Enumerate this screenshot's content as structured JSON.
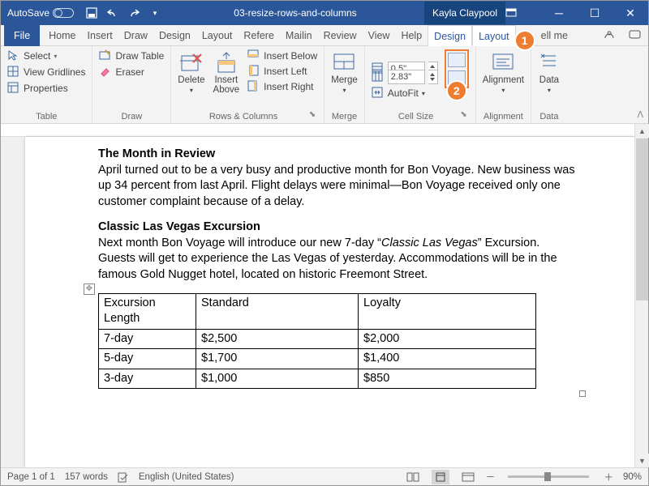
{
  "title": {
    "autosave": "AutoSave",
    "doc": "03-resize-rows-and-columns",
    "user": "Kayla Claypool"
  },
  "tabs": {
    "file": "File",
    "home": "Home",
    "insert": "Insert",
    "draw": "Draw",
    "design": "Design",
    "layout": "Layout",
    "refs": "Refere",
    "mail": "Mailin",
    "review": "Review",
    "view": "View",
    "help": "Help",
    "tt_design": "Design",
    "tt_layout": "Layout",
    "tell": "ell me"
  },
  "callouts": {
    "one": "1",
    "two": "2"
  },
  "ribbon": {
    "table": {
      "select": "Select",
      "gridlines": "View Gridlines",
      "properties": "Properties",
      "label": "Table"
    },
    "draw": {
      "drawtable": "Draw Table",
      "eraser": "Eraser",
      "label": "Draw"
    },
    "rowscols": {
      "delete": "Delete",
      "insertabove": "Insert\nAbove",
      "below": "Insert Below",
      "left": "Insert Left",
      "right": "Insert Right",
      "label": "Rows & Columns"
    },
    "merge": {
      "merge": "Merge",
      "label": "Merge"
    },
    "cellsize": {
      "h": "0.5\"",
      "w": "2.83\"",
      "autofit": "AutoFit",
      "label": "Cell Size"
    },
    "alignment": {
      "label": "Alignment",
      "btn": "Alignment"
    },
    "data": {
      "btn": "Data",
      "label": "Data"
    }
  },
  "doc": {
    "h1": "The Month in Review",
    "p1": "April turned out to be a very busy and productive month for Bon Voyage. New business was up 34 percent from last April. Flight delays were minimal—Bon Voyage received only one customer complaint because of a delay.",
    "h2": "Classic Las Vegas Excursion",
    "p2a": "Next month Bon Voyage will introduce our new 7-day “",
    "p2i": "Classic Las Vegas",
    "p2b": "” Excursion. Guests will get to experience the Las Vegas of yesterday. Accommodations will be in the famous Gold Nugget hotel, located on historic Freemont Street.",
    "table": {
      "headers": [
        "Excursion Length",
        "Standard",
        "Loyalty"
      ],
      "rows": [
        [
          "7-day",
          "$2,500",
          "$2,000"
        ],
        [
          "5-day",
          "$1,700",
          "$1,400"
        ],
        [
          "3-day",
          "$1,000",
          "$850"
        ]
      ]
    }
  },
  "status": {
    "page": "Page 1 of 1",
    "words": "157 words",
    "lang": "English (United States)",
    "zoom": "90%"
  }
}
